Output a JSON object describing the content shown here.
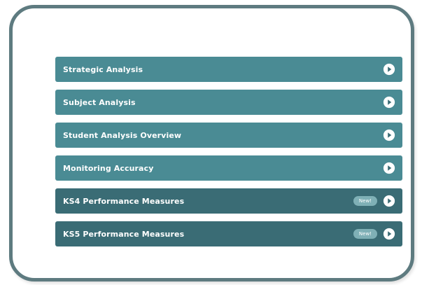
{
  "menu": {
    "items": [
      {
        "label": "Strategic Analysis",
        "style": "light",
        "badge": ""
      },
      {
        "label": "Subject Analysis",
        "style": "light",
        "badge": ""
      },
      {
        "label": "Student Analysis Overview",
        "style": "light",
        "badge": ""
      },
      {
        "label": "Monitoring Accuracy",
        "style": "light",
        "badge": ""
      },
      {
        "label": "KS4 Performance Measures",
        "style": "dark",
        "badge": "New!"
      },
      {
        "label": "KS5 Performance Measures",
        "style": "dark",
        "badge": "New!"
      }
    ],
    "arrow_icon": "play-circle-icon"
  },
  "colors": {
    "frame_border": "#5e7b80",
    "item_light": "#4a8b94",
    "item_dark": "#3a6c75",
    "badge_bg": "#7fb0b6",
    "text": "#ffffff"
  }
}
